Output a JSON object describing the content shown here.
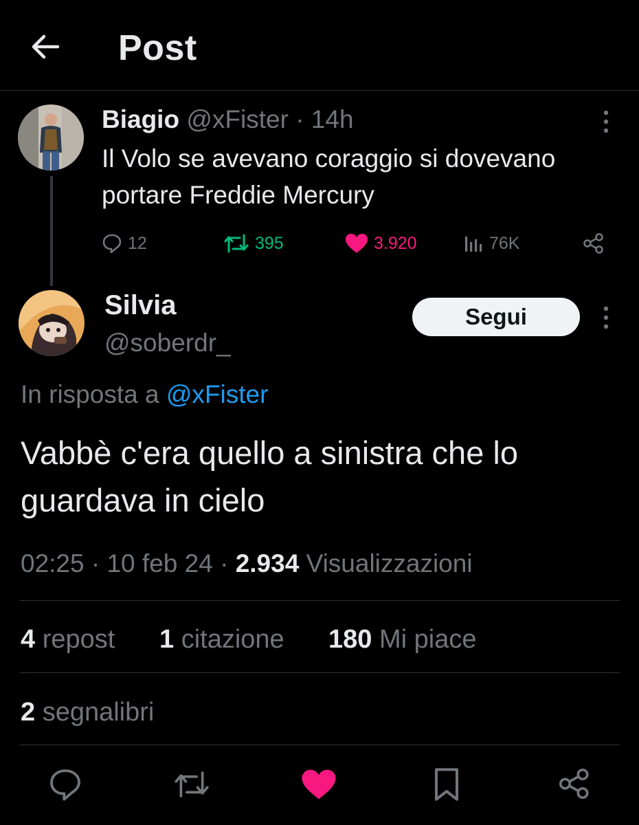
{
  "header": {
    "title": "Post"
  },
  "parent": {
    "name": "Biagio",
    "handle": "@xFister",
    "separator": "·",
    "time": "14h",
    "text": "Il Volo se avevano coraggio si dovevano portare Freddie Mercury",
    "actions": {
      "replies": "12",
      "reposts": "395",
      "likes": "3.920",
      "views": "76K"
    }
  },
  "reply": {
    "name": "Silvia",
    "handle": "@soberdr_",
    "follow_label": "Segui",
    "in_reply_prefix": "In risposta a",
    "in_reply_handle": "@xFister",
    "text": "Vabbè c'era quello a sinistra che lo guardava in cielo",
    "time": "02:25",
    "date": "10 feb 24",
    "views_count": "2.934",
    "views_label": "Visualizzazioni",
    "dot": "·"
  },
  "stats": {
    "reposts_count": "4",
    "reposts_label": "repost",
    "quotes_count": "1",
    "quotes_label": "citazione",
    "likes_count": "180",
    "likes_label": "Mi piace",
    "bookmarks_count": "2",
    "bookmarks_label": "segnalibri"
  },
  "colors": {
    "background": "#000000",
    "text": "#e7e9ea",
    "muted": "#71767b",
    "link": "#1d9bf0",
    "repost_green": "#00ba7c",
    "like_pink": "#f91880",
    "divider": "#2f3336"
  },
  "icons": {
    "back": "arrow-left-icon",
    "more": "more-vertical-icon",
    "reply": "reply-icon",
    "repost": "repost-icon",
    "like": "heart-icon",
    "views": "views-icon",
    "share": "share-icon",
    "bookmark": "bookmark-icon"
  }
}
